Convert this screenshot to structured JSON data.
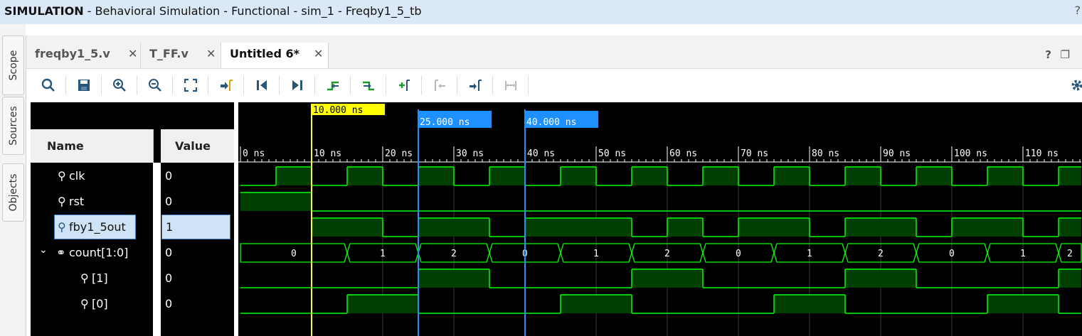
{
  "window": {
    "title_bold": "SIMULATION",
    "title_rest": " - Behavioral Simulation - Functional - sim_1 - Freqby1_5_tb",
    "help": "?"
  },
  "side_tabs": [
    "Scope",
    "Sources",
    "Objects"
  ],
  "tabs": [
    {
      "label": "freqby1_5.v",
      "close": "✕"
    },
    {
      "label": "T_FF.v",
      "close": "✕"
    },
    {
      "label": "Untitled 6*",
      "close": "✕",
      "active": true
    }
  ],
  "tab_window_controls": {
    "help": "?",
    "restore": "❐",
    "max": "▭"
  },
  "toolbar_icons": [
    "search-icon",
    "save-icon",
    "zoom-in-icon",
    "zoom-out-icon",
    "zoom-fit-icon",
    "go-to-cursor-icon",
    "go-to-time-0-icon",
    "go-to-last-time-icon",
    "previous-transition-icon",
    "next-transition-icon",
    "add-marker-icon",
    "previous-marker-icon",
    "next-marker-icon",
    "swap-cursors-icon",
    "settings-icon"
  ],
  "headers": {
    "name": "Name",
    "value": "Value"
  },
  "signals": [
    {
      "name": "clk",
      "value": "0",
      "icon": "wire-icon"
    },
    {
      "name": "rst",
      "value": "0",
      "icon": "wire-icon"
    },
    {
      "name": "fby1_5out",
      "value": "1",
      "icon": "wire-icon",
      "selected": true
    },
    {
      "name": "count[1:0]",
      "value": "0",
      "icon": "bus-icon",
      "expand": "⌄"
    },
    {
      "name": "[1]",
      "value": "0",
      "icon": "wire-icon"
    },
    {
      "name": "[0]",
      "value": "0",
      "icon": "wire-icon"
    }
  ],
  "cursor": {
    "label": "10.000 ns",
    "time_ns": 10
  },
  "markers": [
    {
      "label": "25.000 ns",
      "time_ns": 25
    },
    {
      "label": "40.000 ns",
      "time_ns": 40
    }
  ],
  "time_ruler": [
    "0 ns",
    "10 ns",
    "20 ns",
    "30 ns",
    "40 ns",
    "50 ns",
    "60 ns",
    "70 ns",
    "80 ns",
    "90 ns",
    "100 ns",
    "110 ns"
  ],
  "colors": {
    "wave_high": "#00ff00",
    "wave_fill": "#003f00",
    "cursor": "#ffff00",
    "marker": "#1e90ff",
    "red_x": "#ff0000"
  },
  "waveforms": {
    "clk": [
      [
        0,
        0
      ],
      [
        5,
        1
      ],
      [
        10,
        0
      ],
      [
        15,
        1
      ],
      [
        20,
        0
      ],
      [
        25,
        1
      ],
      [
        30,
        0
      ],
      [
        35,
        1
      ],
      [
        40,
        0
      ],
      [
        45,
        1
      ],
      [
        50,
        0
      ],
      [
        55,
        1
      ],
      [
        60,
        0
      ],
      [
        65,
        1
      ],
      [
        70,
        0
      ],
      [
        75,
        1
      ],
      [
        80,
        0
      ],
      [
        85,
        1
      ],
      [
        90,
        0
      ],
      [
        95,
        1
      ],
      [
        100,
        0
      ],
      [
        105,
        1
      ],
      [
        110,
        0
      ],
      [
        115,
        1
      ]
    ],
    "rst": [
      [
        0,
        1
      ],
      [
        10,
        0
      ]
    ],
    "fby1_5out": [
      [
        10,
        1
      ],
      [
        20,
        0
      ],
      [
        25,
        1
      ],
      [
        35,
        0
      ],
      [
        40,
        1
      ],
      [
        55,
        0
      ],
      [
        60,
        1
      ],
      [
        65,
        0
      ],
      [
        70,
        1
      ],
      [
        80,
        0
      ],
      [
        85,
        1
      ],
      [
        95,
        0
      ],
      [
        100,
        1
      ],
      [
        110,
        0
      ],
      [
        115,
        1
      ]
    ],
    "count_bus": [
      [
        0,
        "0"
      ],
      [
        15,
        "1"
      ],
      [
        25,
        "2"
      ],
      [
        35,
        "0"
      ],
      [
        45,
        "1"
      ],
      [
        55,
        "2"
      ],
      [
        65,
        "0"
      ],
      [
        75,
        "1"
      ],
      [
        85,
        "2"
      ],
      [
        95,
        "0"
      ],
      [
        105,
        "1"
      ],
      [
        115,
        "2"
      ]
    ],
    "count1": [
      [
        0,
        0
      ],
      [
        25,
        1
      ],
      [
        35,
        0
      ],
      [
        55,
        1
      ],
      [
        65,
        0
      ],
      [
        85,
        1
      ],
      [
        95,
        0
      ],
      [
        115,
        1
      ]
    ],
    "count0": [
      [
        0,
        0
      ],
      [
        15,
        1
      ],
      [
        25,
        0
      ],
      [
        45,
        1
      ],
      [
        55,
        0
      ],
      [
        75,
        1
      ],
      [
        85,
        0
      ],
      [
        105,
        1
      ],
      [
        115,
        0
      ]
    ]
  }
}
